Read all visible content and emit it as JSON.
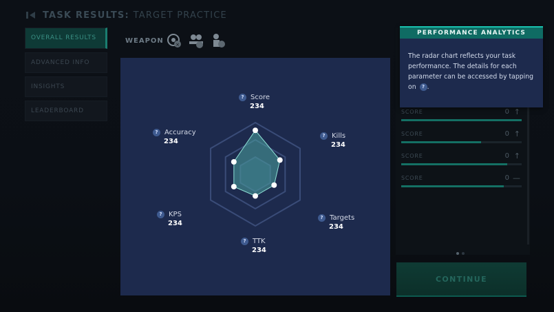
{
  "header": {
    "title_main": "TASK RESULTS:",
    "title_sub": "TARGET PRACTICE"
  },
  "nav": {
    "items": [
      {
        "label": "OVERALL RESULTS",
        "active": true
      },
      {
        "label": "ADVANCED INFO",
        "active": false
      },
      {
        "label": "INSIGHTS",
        "active": false
      },
      {
        "label": "LEADERBOARD",
        "active": false
      }
    ]
  },
  "weapon": {
    "label": "WEAPON",
    "icons": [
      "crosshair-icon",
      "sniper-team-icon",
      "soldier-icon"
    ]
  },
  "radar": {
    "levels": 3,
    "axes": [
      {
        "label": "Score",
        "value": "234",
        "level": 0.85
      },
      {
        "label": "Kills",
        "value": "234",
        "level": 0.55
      },
      {
        "label": "Targets",
        "value": "234",
        "level": 0.42
      },
      {
        "label": "TTK",
        "value": "234",
        "level": 0.42
      },
      {
        "label": "KPS",
        "value": "234",
        "level": 0.48
      },
      {
        "label": "Accuracy",
        "value": "234",
        "level": 0.48
      }
    ],
    "help_glyph": "?"
  },
  "scores": [
    {
      "label": "SCORE",
      "value": "0",
      "arrow": "↑",
      "fill": 1.0
    },
    {
      "label": "SCORE",
      "value": "0",
      "arrow": "↑",
      "fill": 0.66
    },
    {
      "label": "SCORE",
      "value": "0",
      "arrow": "↑",
      "fill": 0.88
    },
    {
      "label": "SCORE",
      "value": "0",
      "arrow": "—",
      "fill": 0.85
    }
  ],
  "pager": {
    "pages": 2,
    "current": 1
  },
  "continue_label": "CONTINUE",
  "tooltip": {
    "title": "PERFORMANCE ANALYTICS",
    "body_before": "The radar chart reflects your task performance. The details for each parameter can be accessed by tapping on",
    "body_after": "."
  },
  "colors": {
    "accent": "#19c3b0",
    "chart_bg": "#1d2a4d",
    "radar_fill": "#4aa3a0"
  }
}
